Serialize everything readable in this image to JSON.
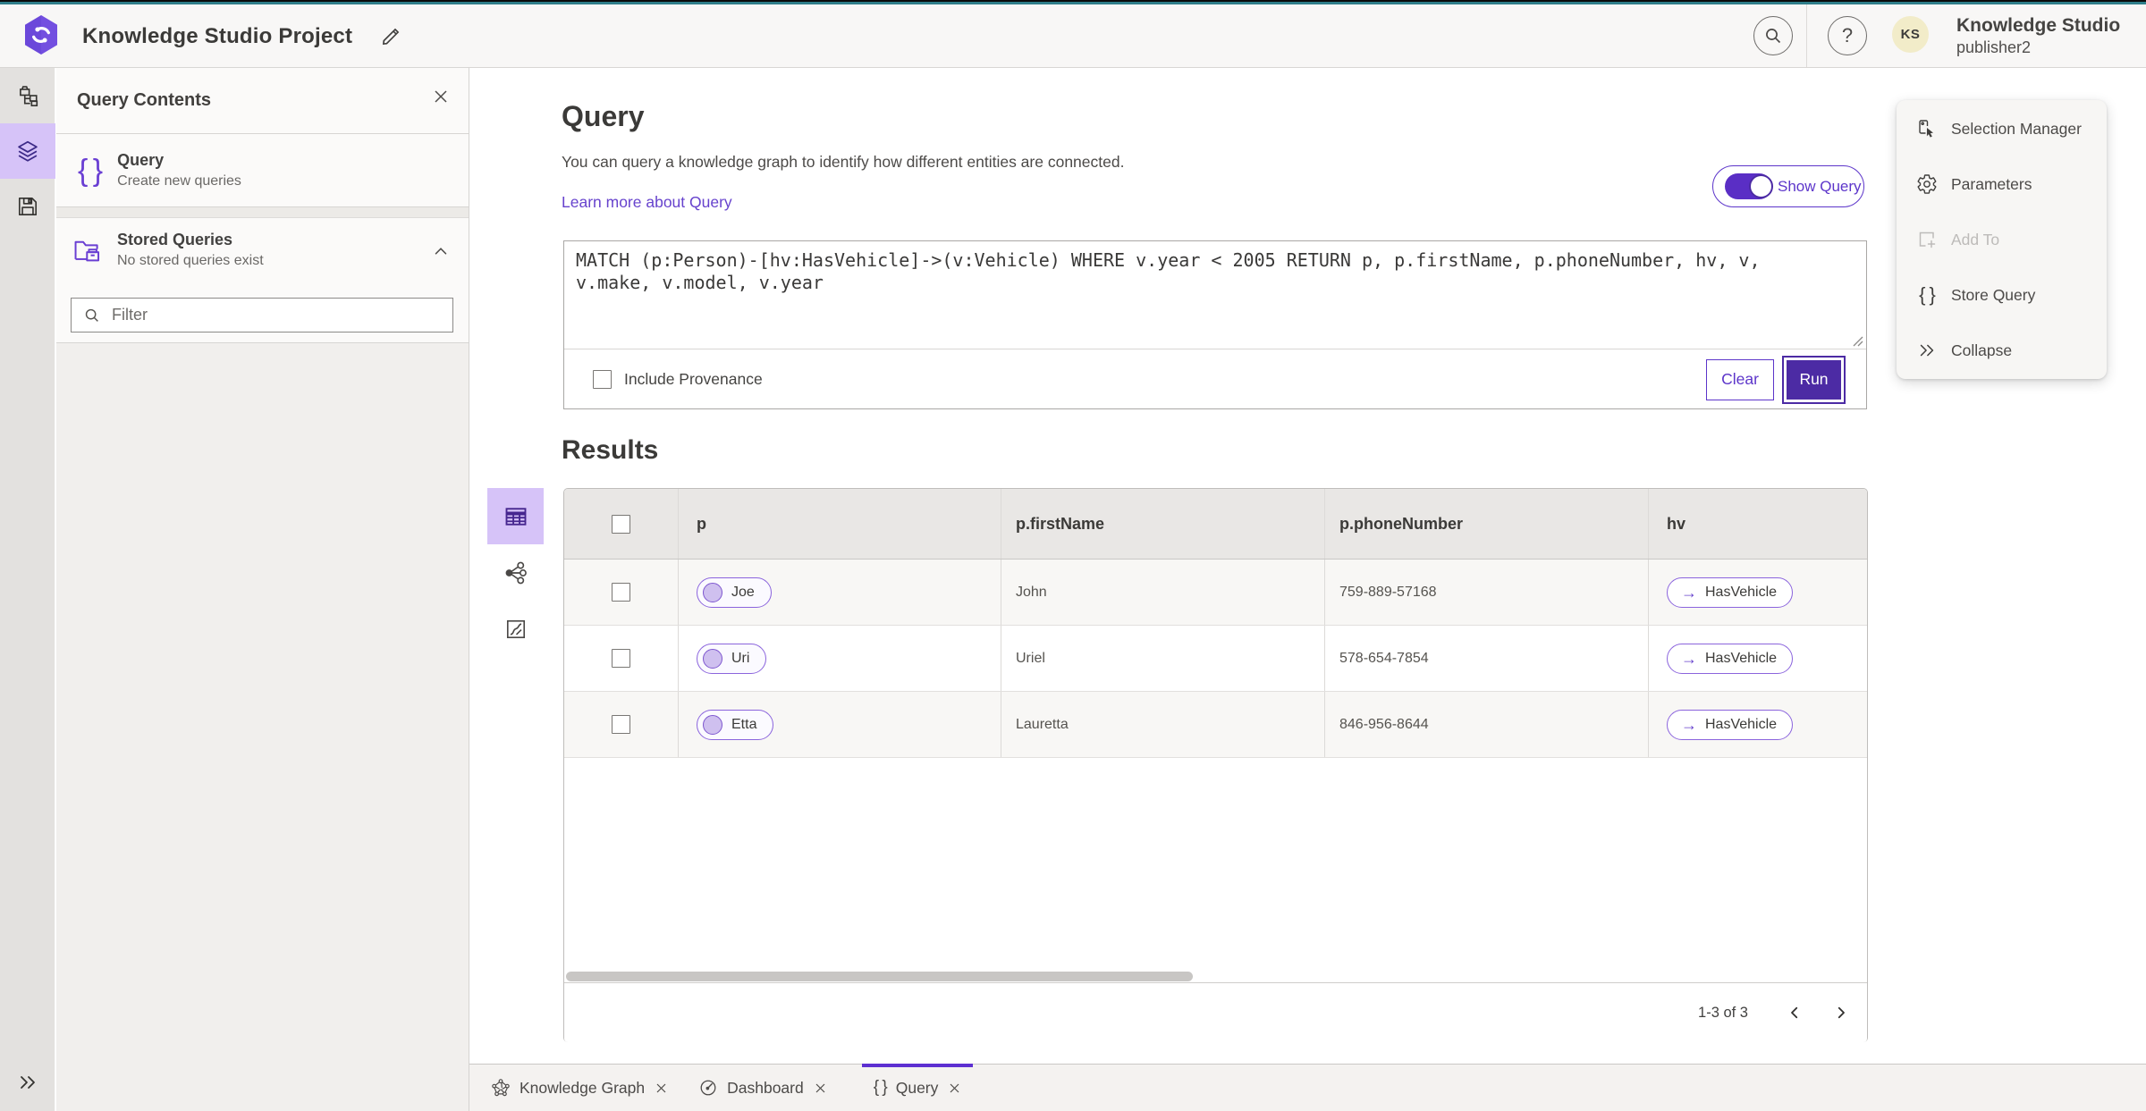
{
  "header": {
    "title": "Knowledge Studio Project",
    "user_name": "Knowledge Studio",
    "user_role": "publisher2",
    "avatar_initials": "KS",
    "help_glyph": "?"
  },
  "left_panel": {
    "title": "Query Contents",
    "query_item": {
      "title": "Query",
      "subtitle": "Create new queries"
    },
    "stored_queries": {
      "title": "Stored Queries",
      "subtitle": "No stored queries exist"
    },
    "filter_placeholder": "Filter"
  },
  "query_section": {
    "heading": "Query",
    "description": "You can query a knowledge graph to identify how different entities are connected.",
    "learn_more": "Learn more about Query",
    "show_query_label": "Show Query",
    "query_text": "MATCH (p:Person)-[hv:HasVehicle]->(v:Vehicle) WHERE v.year < 2005 RETURN p, p.firstName, p.phoneNumber, hv, v, v.make, v.model, v.year",
    "include_provenance_label": "Include Provenance",
    "clear_label": "Clear",
    "run_label": "Run"
  },
  "results": {
    "heading": "Results",
    "columns": {
      "p": "p",
      "first_name": "p.firstName",
      "phone": "p.phoneNumber",
      "hv": "hv"
    },
    "rows": [
      {
        "entity": "Joe",
        "first_name": "John",
        "phone": "759-889-57168",
        "relationship": "HasVehicle"
      },
      {
        "entity": "Uri",
        "first_name": "Uriel",
        "phone": "578-654-7854",
        "relationship": "HasVehicle"
      },
      {
        "entity": "Etta",
        "first_name": "Lauretta",
        "phone": "846-956-8644",
        "relationship": "HasVehicle"
      }
    ],
    "pagination": {
      "range_label": "1-3 of 3"
    }
  },
  "tools_menu": {
    "selection_manager": "Selection Manager",
    "parameters": "Parameters",
    "add_to": "Add To",
    "store_query": "Store Query",
    "collapse": "Collapse"
  },
  "bottom_tabs": {
    "knowledge_graph": "Knowledge Graph",
    "dashboard": "Dashboard",
    "query": "Query"
  },
  "icons": {
    "braces": "{ }",
    "arrow_right": "→"
  },
  "colors": {
    "accent_purple": "#5c35ca",
    "deep_purple": "#4c2ba4",
    "selected_purple_bg": "#d6c3f8",
    "teal_strip": "#2f7e8a",
    "avatar_bg": "#f2ecc9"
  }
}
